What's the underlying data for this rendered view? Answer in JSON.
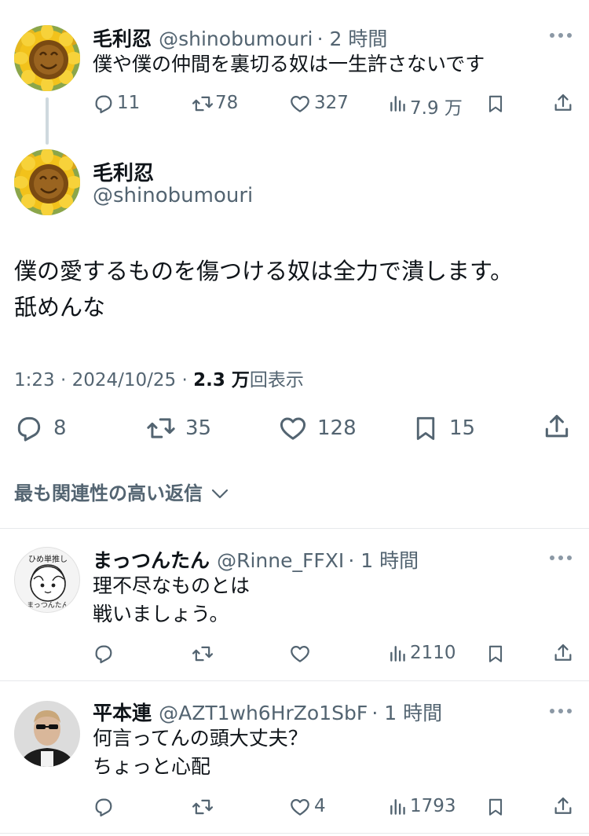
{
  "colors": {
    "text": "#0f1419",
    "muted": "#536471",
    "divider": "#e6e9eb",
    "thread_line": "#cfd9de"
  },
  "parent_tweet": {
    "name": "毛利忍",
    "handle": "@shinobumouri",
    "time": "· 2 時間",
    "text": "僕や僕の仲間を裏切る奴は一生許さないです",
    "reply_count": "11",
    "retweet_count": "78",
    "like_count": "327",
    "view_count": "7.9 万",
    "avatar_icon": "sunflower-avatar"
  },
  "main_tweet": {
    "name": "毛利忍",
    "handle": "@shinobumouri",
    "text_line1": "僕の愛するものを傷つける奴は全力で潰します。",
    "text_line2": "舐めんな",
    "meta_time": "1:23 · 2024/10/25 · ",
    "meta_views": "2.3 万",
    "meta_views_suffix": "回表示",
    "reply_count": "8",
    "retweet_count": "35",
    "like_count": "128",
    "bookmark_count": "15",
    "avatar_icon": "sunflower-avatar"
  },
  "sort": {
    "label": "最も関連性の高い返信",
    "icon": "chevron-down-icon"
  },
  "replies": [
    {
      "name": "まっつんたん",
      "handle": "@Rinne_FFXI",
      "time": "· 1 時間",
      "text_line1": "理不尽なものとは",
      "text_line2": "戦いましょう。",
      "reply_count": "",
      "retweet_count": "",
      "like_count": "",
      "view_count": "2110",
      "avatar_icon": "drawn-face-avatar",
      "avatar_text_top": "ひめ単推し",
      "avatar_text_bottom": "まっつんたん"
    },
    {
      "name": "平本連",
      "handle": "@AZT1wh6HrZo1SbF",
      "time": "· 1 時間",
      "text_line1": "何言ってんの頭大丈夫？",
      "text_line2": "ちょっと心配",
      "reply_count": "",
      "retweet_count": "",
      "like_count": "4",
      "view_count": "1793",
      "avatar_icon": "person-photo-avatar"
    }
  ]
}
